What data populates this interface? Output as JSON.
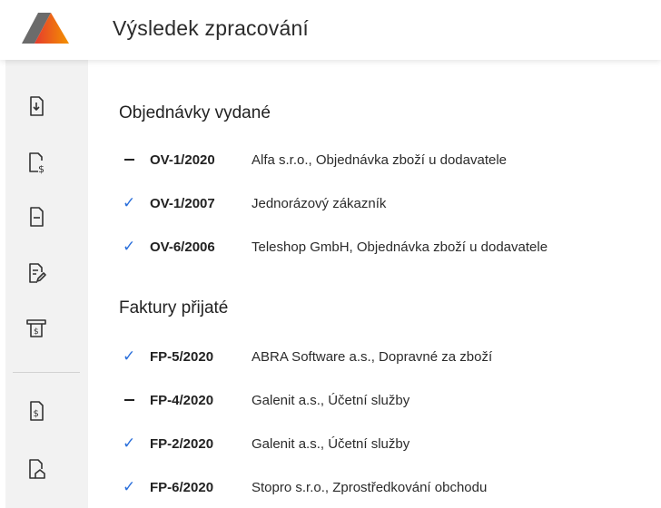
{
  "header": {
    "title": "Výsledek zpracování",
    "logo_icon": "abra-logo-icon"
  },
  "sidebar": {
    "items": [
      {
        "icon": "document-download-icon"
      },
      {
        "icon": "document-dollar-icon"
      },
      {
        "icon": "document-minus-icon"
      },
      {
        "icon": "document-edit-icon"
      },
      {
        "icon": "cash-register-icon"
      },
      {
        "icon": "receipt-dollar-icon"
      },
      {
        "icon": "document-home-icon"
      }
    ]
  },
  "sections": [
    {
      "title": "Objednávky vydané",
      "rows": [
        {
          "status": "dash",
          "code": "OV-1/2020",
          "desc": "Alfa s.r.o., Objednávka zboží u dodavatele"
        },
        {
          "status": "check",
          "code": "OV-1/2007",
          "desc": "Jednorázový zákazník"
        },
        {
          "status": "check",
          "code": "OV-6/2006",
          "desc": "Teleshop GmbH, Objednávka zboží u dodavatele"
        }
      ]
    },
    {
      "title": "Faktury přijaté",
      "rows": [
        {
          "status": "check",
          "code": "FP-5/2020",
          "desc": "ABRA Software a.s., Dopravné za zboží"
        },
        {
          "status": "dash",
          "code": "FP-4/2020",
          "desc": "Galenit a.s., Účetní služby"
        },
        {
          "status": "check",
          "code": "FP-2/2020",
          "desc": "Galenit a.s., Účetní služby"
        },
        {
          "status": "check",
          "code": "FP-6/2020",
          "desc": "Stopro s.r.o., Zprostředkování obchodu"
        }
      ]
    }
  ],
  "colors": {
    "accent_check": "#2a6fdb",
    "logo_gray": "#6b6b6b",
    "logo_orange": "#f39200",
    "logo_red": "#e63a2e"
  }
}
